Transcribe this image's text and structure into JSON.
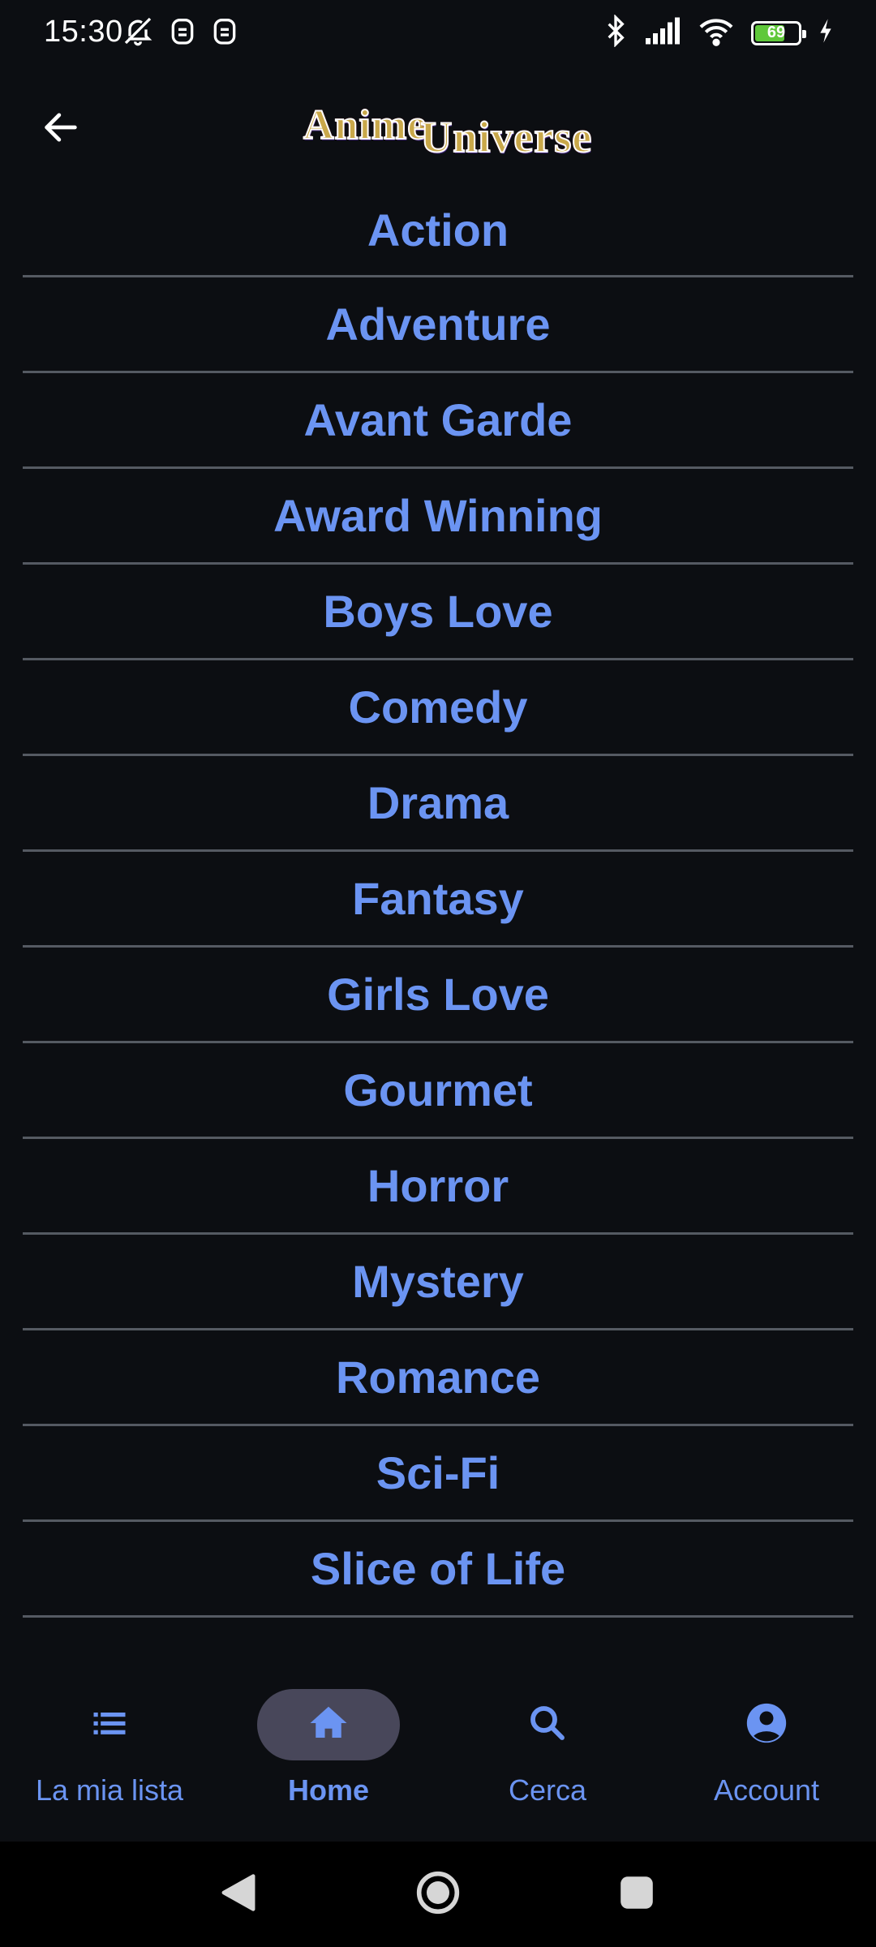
{
  "status_bar": {
    "time": "15:30",
    "battery_level": "69",
    "battery_fraction": 0.69,
    "icons": [
      "bell-off-icon",
      "notification-icon",
      "notification-icon",
      "bluetooth-icon",
      "signal-icon",
      "wifi-icon",
      "battery-icon",
      "charging-icon"
    ]
  },
  "header": {
    "back_icon": "arrow-left-icon",
    "logo_part1": "Anime",
    "logo_part2": "Universe"
  },
  "genres": [
    "Action",
    "Adventure",
    "Avant Garde",
    "Award Winning",
    "Boys Love",
    "Comedy",
    "Drama",
    "Fantasy",
    "Girls Love",
    "Gourmet",
    "Horror",
    "Mystery",
    "Romance",
    "Sci-Fi",
    "Slice of Life"
  ],
  "bottom_nav": {
    "items": [
      {
        "label": "La mia lista",
        "icon": "list-icon",
        "active": false
      },
      {
        "label": "Home",
        "icon": "home-icon",
        "active": true
      },
      {
        "label": "Cerca",
        "icon": "search-icon",
        "active": false
      },
      {
        "label": "Account",
        "icon": "account-icon",
        "active": false
      }
    ]
  },
  "system_nav": {
    "icons": [
      "back-triangle-icon",
      "home-circle-icon",
      "recents-square-icon"
    ]
  },
  "colors": {
    "background": "#0c0e12",
    "accent": "#6b94f2",
    "divider": "#555a62",
    "active_pill": "#48475a",
    "battery_green": "#5fc83a"
  }
}
